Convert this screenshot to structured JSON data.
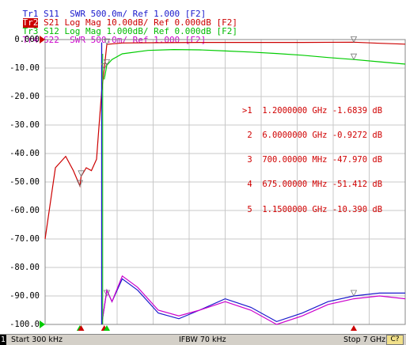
{
  "traces": [
    {
      "id": "Tr1",
      "text": " S11  SWR 500.0m/ Ref 1.000 [F2]",
      "color": "#1a1acc",
      "active": false
    },
    {
      "id": "Tr2",
      "text": " S21 Log Mag 10.00dB/ Ref 0.000dB [F2]",
      "color": "#cc0000",
      "active": true
    },
    {
      "id": "Tr3",
      "text": " S12 Log Mag 1.000dB/ Ref 0.000dB [F2]",
      "color": "#00bb00",
      "active": false
    },
    {
      "id": "Tr4",
      "text": " S22  SWR 500.0m/ Ref 1.000 [F2]",
      "color": "#cc00cc",
      "active": false
    }
  ],
  "y_axis_labels": [
    "0.000",
    "-10.00",
    "-20.00",
    "-30.00",
    "-40.00",
    "-50.00",
    "-60.00",
    "-70.00",
    "-80.00",
    "-90.00",
    "-100.0"
  ],
  "markers": [
    {
      "num": ">1",
      "freq": "1.2000000 GHz",
      "value": "-1.6839 dB"
    },
    {
      "num": " 2",
      "freq": "6.0000000 GHz",
      "value": "-0.9272 dB"
    },
    {
      "num": " 3",
      "freq": "700.00000 MHz",
      "value": "-47.970 dB"
    },
    {
      "num": " 4",
      "freq": "675.00000 MHz",
      "value": "-51.412 dB"
    },
    {
      "num": " 5",
      "freq": "1.1500000 GHz",
      "value": "-10.390 dB"
    }
  ],
  "status": {
    "channel": "1",
    "start": "Start 300 kHz",
    "ifbw": "IFBW 70 kHz",
    "stop": "Stop 7 GHz",
    "cal": "C?"
  },
  "colors": {
    "s11": "#1a1acc",
    "s21": "#cc0000",
    "s12": "#00cc00",
    "s22": "#cc00cc",
    "grid": "#c8c8c8"
  },
  "chart_data": {
    "type": "line",
    "title": "",
    "xlabel": "",
    "ylabel": "",
    "xlim_ghz": [
      0.0003,
      7.0
    ],
    "ylim": [
      -100,
      0
    ],
    "grid": true,
    "series": [
      {
        "name": "S21",
        "x": [
          0.0003,
          0.2,
          0.4,
          0.55,
          0.675,
          0.7,
          0.8,
          0.9,
          1.0,
          1.05,
          1.1,
          1.15,
          1.2,
          1.5,
          2.0,
          3.0,
          4.0,
          5.0,
          6.0,
          6.5,
          7.0
        ],
        "values": [
          -70,
          -45,
          -41,
          -46,
          -51.4,
          -48.0,
          -45,
          -46,
          -42,
          -30,
          -18,
          -10.4,
          -1.68,
          -1.2,
          -1.1,
          -1.0,
          -1.0,
          -1.0,
          -0.93,
          -1.3,
          -1.6
        ]
      },
      {
        "name": "S12",
        "x": [
          1.15,
          1.2,
          1.3,
          1.5,
          2.0,
          2.5,
          3.0,
          3.5,
          4.0,
          4.5,
          5.0,
          5.5,
          6.0,
          6.5,
          7.0
        ],
        "values": [
          -14,
          -9,
          -7,
          -5,
          -3.8,
          -3.5,
          -3.6,
          -4,
          -4.4,
          -4.9,
          -5.5,
          -6.3,
          -7.0,
          -7.8,
          -8.6
        ]
      },
      {
        "name": "S11",
        "x": [
          1.1,
          1.2,
          1.3,
          1.5,
          1.8,
          2.2,
          2.6,
          3.0,
          3.5,
          4.0,
          4.5,
          5.0,
          5.5,
          6.0,
          6.5,
          7.0
        ],
        "values": [
          -100,
          -88,
          -92,
          -84,
          -88,
          -96,
          -98,
          -95,
          -91,
          -94,
          -99,
          -96,
          -92,
          -90,
          -89,
          -89
        ]
      },
      {
        "name": "S22",
        "x": [
          1.1,
          1.2,
          1.3,
          1.5,
          1.8,
          2.2,
          2.6,
          3.0,
          3.5,
          4.0,
          4.5,
          5.0,
          5.5,
          6.0,
          6.5,
          7.0
        ],
        "values": [
          -100,
          -88,
          -92,
          -83,
          -87,
          -95,
          -97,
          -95,
          -92,
          -95,
          -100,
          -97,
          -93,
          -91,
          -90,
          -91
        ]
      }
    ]
  }
}
